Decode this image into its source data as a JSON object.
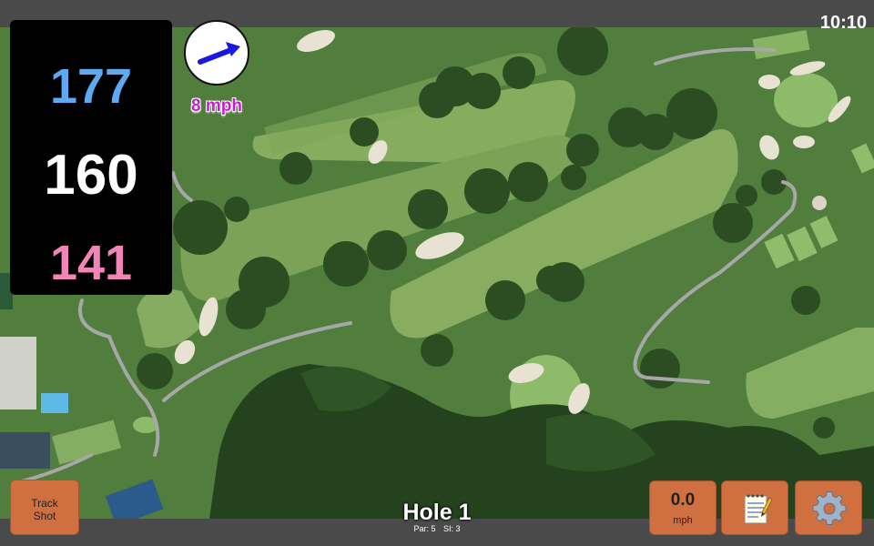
{
  "status": {
    "time": "10:10"
  },
  "distances": {
    "back": "177",
    "middle": "160",
    "front": "141"
  },
  "wind": {
    "speed": "8 mph",
    "icon": "wind-arrow-icon"
  },
  "buttons": {
    "track_shot": {
      "line1": "Track",
      "line2": "Shot"
    },
    "speed": {
      "value": "0.0",
      "unit": "mph"
    },
    "notes": {
      "icon": "notepad-icon"
    },
    "settings": {
      "icon": "gear-icon"
    }
  },
  "hole": {
    "title": "Hole 1",
    "par": "Par: 5",
    "si": "SI: 3"
  },
  "colors": {
    "back": "#5ea9f1",
    "middle": "#ffffff",
    "front": "#f285b8",
    "wind_text": "#c91ecf",
    "button_bg": "#d07041",
    "bar_bg": "#4a4a4a"
  }
}
